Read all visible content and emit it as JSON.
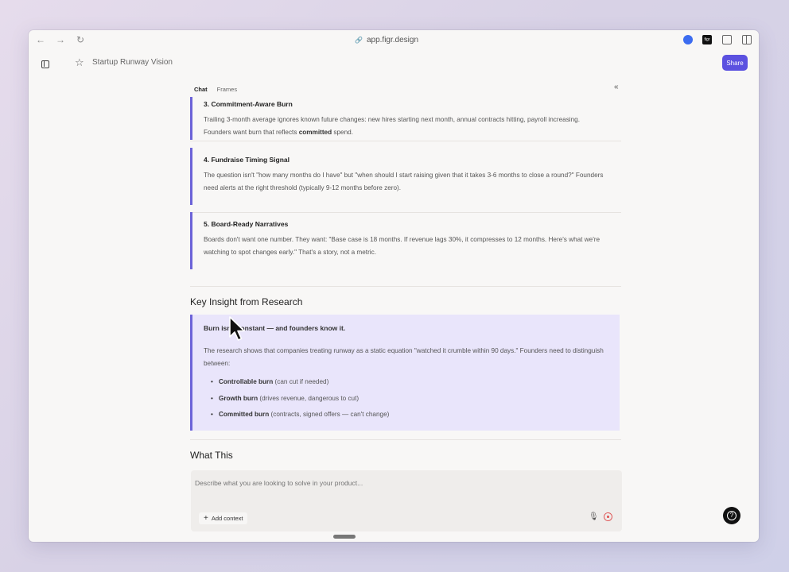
{
  "browser": {
    "url": "app.figr.design",
    "back_icon": "←",
    "forward_icon": "→",
    "reload_icon": "↻",
    "link_icon": "🔗",
    "figr_ext_label": "figr"
  },
  "appbar": {
    "title": "Startup Runway Vision",
    "share_label": "Share",
    "accent": "#5b51e0"
  },
  "tabs": [
    {
      "label": "Chat"
    },
    {
      "label": "Frames"
    }
  ],
  "collapse_icon": "«",
  "cards": [
    {
      "title": "3. Commitment-Aware Burn",
      "body_before": "Trailing 3-month average ignores known future changes: new hires starting next month, annual contracts hitting, payroll increasing. Founders want burn that reflects ",
      "body_bold": "committed",
      "body_after": " spend."
    },
    {
      "title": "4. Fundraise Timing Signal",
      "body": "The question isn't \"how many months do I have\" but \"when should I start raising given that it takes 3-6 months to close a round?\" Founders need alerts at the right threshold (typically 9-12 months before zero)."
    },
    {
      "title": "5. Board-Ready Narratives",
      "body": "Boards don't want one number. They want: \"Base case is 18 months. If revenue lags 30%, it compresses to 12 months. Here's what we're watching to spot changes early.\" That's a story, not a metric."
    }
  ],
  "insight": {
    "heading": "Key Insight from Research",
    "title": "Burn isn't constant — and founders know it.",
    "body": "The research shows that companies treating runway as a static equation \"watched it crumble within 90 days.\" Founders need to distinguish between:",
    "bullets": [
      {
        "bold": "Controllable burn",
        "rest": " (can cut if needed)"
      },
      {
        "bold": "Growth burn",
        "rest": " (drives revenue, dangerous to cut)"
      },
      {
        "bold": "Committed burn",
        "rest": " (contracts, signed offers — can't change)"
      }
    ]
  },
  "next_heading": "What This",
  "composer": {
    "placeholder": "Describe what you are looking to solve in your product...",
    "add_context_label": "Add context",
    "plus_icon": "+",
    "mic_icon": "🎙"
  },
  "help_icon": "?"
}
